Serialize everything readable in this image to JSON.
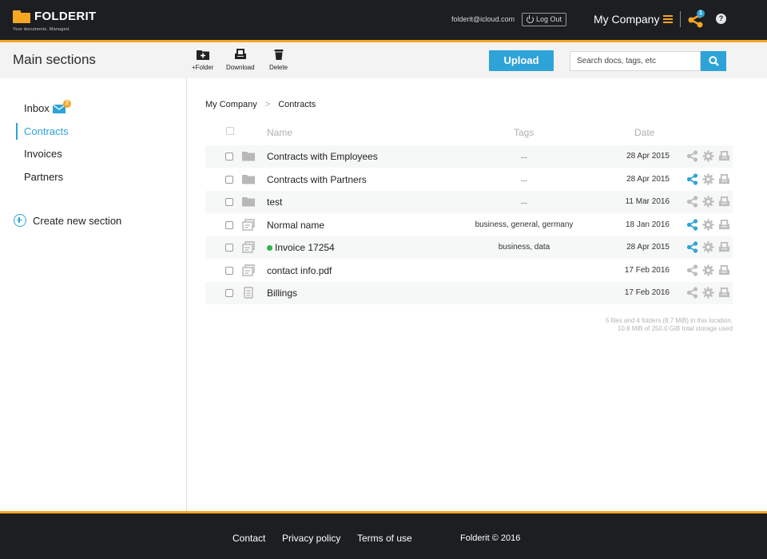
{
  "brand": {
    "name": "FOLDERIT",
    "tagline": "Your documents. Managed."
  },
  "header": {
    "email": "folderit@icloud.com",
    "logout_label": "Log Out",
    "company": "My Company",
    "share_badge": "1",
    "help": "?"
  },
  "toolbar": {
    "section_title": "Main sections",
    "add_folder_label": "+Folder",
    "download_label": "Download",
    "delete_label": "Delete",
    "upload_label": "Upload",
    "search_placeholder": "Search docs, tags, etc"
  },
  "sidebar": {
    "items": [
      {
        "label": "Inbox",
        "badge": "2"
      },
      {
        "label": "Contracts",
        "active": true
      },
      {
        "label": "Invoices"
      },
      {
        "label": "Partners"
      }
    ],
    "create_label": "Create new section"
  },
  "breadcrumb": {
    "root": "My Company",
    "separator": ">",
    "current": "Contracts"
  },
  "table": {
    "headers": {
      "name": "Name",
      "tags": "Tags",
      "date": "Date"
    },
    "rows": [
      {
        "type": "folder",
        "name": "Contracts with Employees",
        "tags": "...",
        "date": "28 Apr 2015",
        "shared": false
      },
      {
        "type": "folder",
        "name": "Contracts with Partners",
        "tags": "...",
        "date": "28 Apr 2015",
        "shared": true
      },
      {
        "type": "folder",
        "name": "test",
        "tags": "...",
        "date": "11 Mar 2016",
        "shared": false
      },
      {
        "type": "doc",
        "name": "Normal name",
        "tags": "business, general, germany",
        "date": "18 Jan 2016",
        "shared": true
      },
      {
        "type": "doc",
        "name": "Invoice 17254",
        "tags": "business, data",
        "date": "28 Apr 2015",
        "shared": true,
        "status_dot": true
      },
      {
        "type": "doc",
        "name": "contact info.pdf",
        "tags": "",
        "date": "17 Feb 2016",
        "shared": false
      },
      {
        "type": "file",
        "name": "Billings",
        "tags": "",
        "date": "17 Feb 2016",
        "shared": false
      }
    ]
  },
  "storage": {
    "line1": "5 files and 4 folders (8.7 MiB) in this location.",
    "line2": "10.8 MiB of 250.0 GiB total storage used"
  },
  "footer": {
    "contact": "Contact",
    "privacy": "Privacy policy",
    "terms": "Terms of use",
    "copyright": "Folderit © 2016"
  },
  "colors": {
    "accent": "#f5a623",
    "primary": "#2ea3d8",
    "dark": "#1c1e22",
    "status_green": "#2db34a"
  }
}
